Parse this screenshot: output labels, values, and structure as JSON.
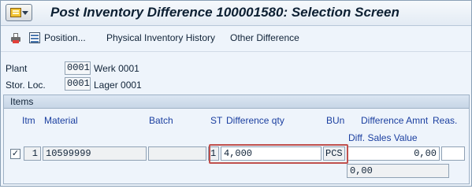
{
  "window": {
    "title": "Post Inventory Difference 100001580: Selection Screen"
  },
  "toolbar": {
    "position_label": "Position...",
    "physical_inventory_history_label": "Physical Inventory History",
    "other_difference_label": "Other Difference"
  },
  "header": {
    "plant": {
      "label": "Plant",
      "code": "0001",
      "name": "Werk 0001"
    },
    "storage_location": {
      "label": "Stor. Loc.",
      "code": "0001",
      "name": "Lager 0001"
    }
  },
  "items": {
    "title": "Items",
    "columns": {
      "itm": "Itm",
      "material": "Material",
      "batch": "Batch",
      "st": "ST",
      "difference_qty": "Difference qty",
      "bun": "BUn",
      "difference_amnt": "Difference Amnt",
      "reas": "Reas.",
      "diff_sales_value": "Diff. Sales Value"
    },
    "rows": [
      {
        "selected": true,
        "checkbox_glyph": "✓",
        "itm": "1",
        "material": "10599999",
        "batch": "",
        "st": "1",
        "difference_qty": "4,000",
        "bun": "PCS",
        "difference_amnt": "0,00",
        "reas": "",
        "diff_sales_value": "0,00"
      }
    ]
  },
  "highlight_color": "#c0504d"
}
